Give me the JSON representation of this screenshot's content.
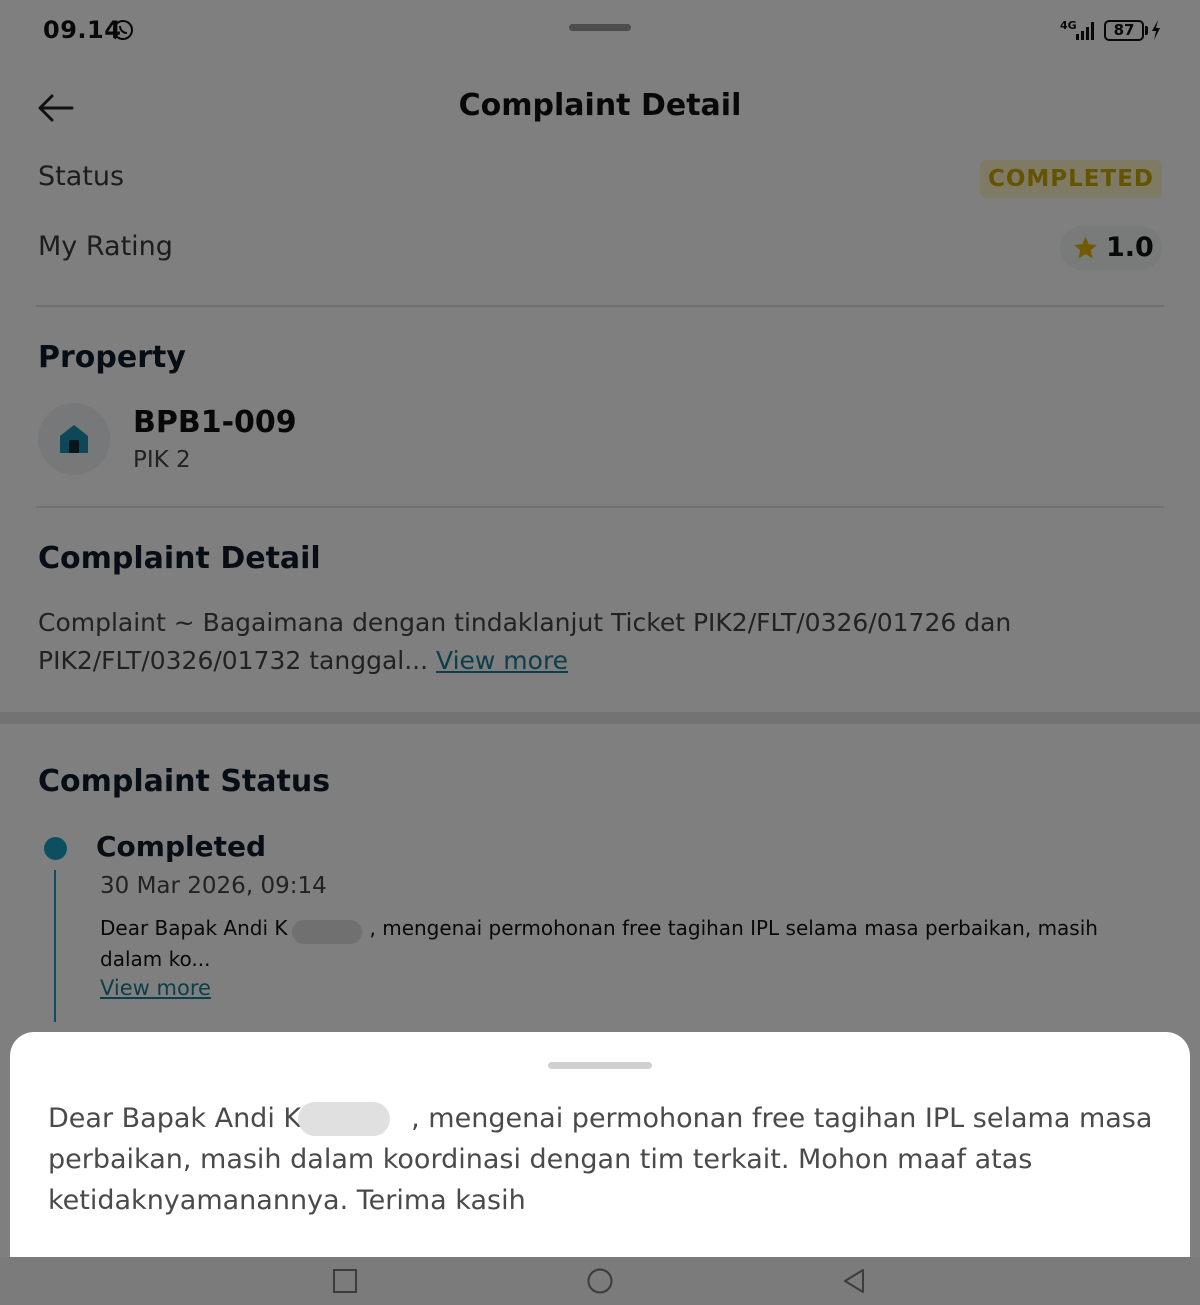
{
  "status_bar": {
    "time": "09.14",
    "network": "4G",
    "battery": "87"
  },
  "header": {
    "title": "Complaint Detail"
  },
  "summary": {
    "status_label": "Status",
    "status_value": "COMPLETED",
    "rating_label": "My Rating",
    "rating_value": "1.0"
  },
  "property": {
    "section_title": "Property",
    "code": "BPB1-009",
    "area": "PIK 2"
  },
  "complaint_detail": {
    "section_title": "Complaint Detail",
    "text": "Complaint ~ Bagaimana dengan tindaklanjut Ticket PIK2/FLT/0326/01726 dan PIK2/FLT/0326/01732 tanggal...",
    "view_more": "View more"
  },
  "complaint_status": {
    "section_title": "Complaint Status",
    "entries": [
      {
        "title": "Completed",
        "date": "30 Mar 2026, 09:14",
        "message": "Dear Bapak Andi K",
        "message_rest": ", mengenai permohonan free tagihan IPL selama masa perbaikan, masih dalam ko...",
        "view_more": "View more"
      }
    ]
  },
  "sheet": {
    "text_start": "Dear Bapak Andi K",
    "text_rest": ", mengenai permohonan free tagihan IPL selama masa perbaikan, masih dalam koordinasi dengan tim terkait. Mohon maaf atas ketidaknyamanannya. Terima kasih"
  },
  "colors": {
    "accent": "#1a9ec2",
    "status_completed_text": "#c9a700",
    "status_completed_bg": "#fff5c8",
    "link": "#1a7c96"
  },
  "icons": [
    "whatsapp-icon",
    "signal-icon",
    "battery-icon",
    "charging-icon",
    "back-arrow-icon",
    "star-icon",
    "house-icon",
    "recent-apps-icon",
    "home-icon",
    "back-nav-icon"
  ]
}
